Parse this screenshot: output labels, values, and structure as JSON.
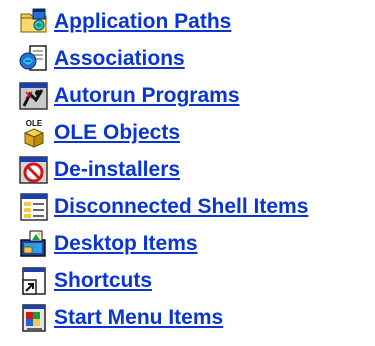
{
  "links": [
    {
      "label": "Application Paths",
      "icon": "application-paths-icon"
    },
    {
      "label": "Associations",
      "icon": "associations-icon"
    },
    {
      "label": "Autorun Programs",
      "icon": "autorun-icon"
    },
    {
      "label": "OLE Objects",
      "icon": "ole-objects-icon"
    },
    {
      "label": "De-installers",
      "icon": "de-installers-icon"
    },
    {
      "label": "Disconnected Shell Items",
      "icon": "disconnected-shell-items-icon"
    },
    {
      "label": "Desktop Items",
      "icon": "desktop-items-icon"
    },
    {
      "label": "Shortcuts",
      "icon": "shortcuts-icon"
    },
    {
      "label": "Start Menu Items",
      "icon": "start-menu-items-icon"
    }
  ],
  "icon_text": {
    "ole": "OLE"
  },
  "colors": {
    "link": "#0a36cf",
    "background": "#ffffff"
  }
}
